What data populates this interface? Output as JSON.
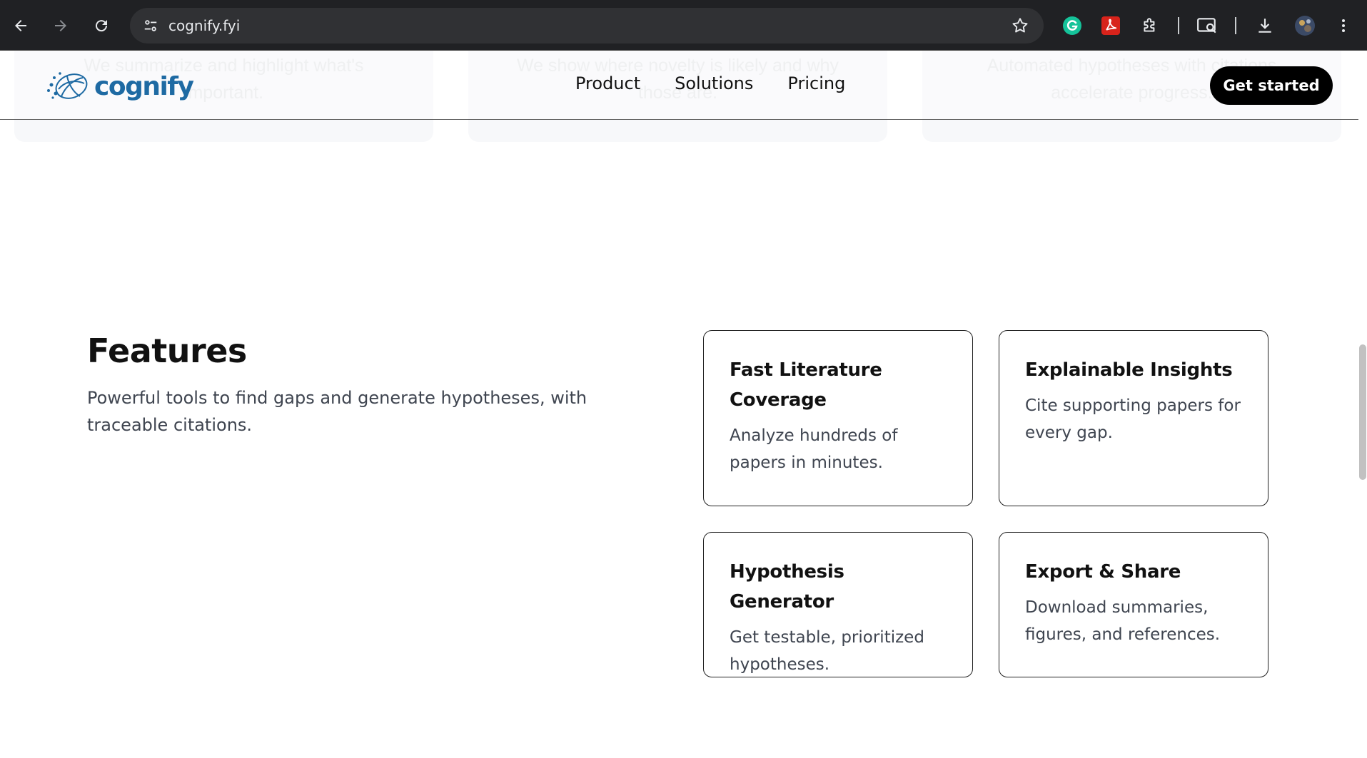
{
  "browser": {
    "url": "cognify.fyi",
    "icons": [
      "back-arrow-icon",
      "forward-arrow-icon",
      "reload-icon",
      "site-settings-icon",
      "bookmark-star-icon",
      "grammarly-icon",
      "pdf-icon",
      "extensions-puzzle-icon",
      "reading-mode-icon",
      "download-icon",
      "profile-avatar-icon",
      "more-vertical-icon"
    ]
  },
  "faded": {
    "cards": [
      {
        "line1": "We summarize and highlight what's",
        "line2": "important."
      },
      {
        "line1": "We show where novelty is likely and why",
        "line2": "those are."
      },
      {
        "line1": "Automated hypotheses with citations",
        "line2": "accelerate progress."
      }
    ]
  },
  "header": {
    "logo_text": "cognify",
    "nav": [
      "Product",
      "Solutions",
      "Pricing"
    ],
    "cta_label": "Get started"
  },
  "features": {
    "title": "Features",
    "subtitle": "Powerful tools to find gaps and generate hypotheses, with traceable citations.",
    "cards": [
      {
        "title": "Fast Literature Coverage",
        "body": "Analyze hundreds of papers in minutes."
      },
      {
        "title": "Explainable Insights",
        "body": "Cite supporting papers for every gap."
      },
      {
        "title": "Hypothesis Generator",
        "body": "Get testable, prioritized hypotheses."
      },
      {
        "title": "Export & Share",
        "body": "Download summaries, figures, and references."
      }
    ]
  },
  "colors": {
    "brand": "#1e6aa3",
    "cta_bg": "#000000",
    "chrome_bg": "#202124"
  }
}
